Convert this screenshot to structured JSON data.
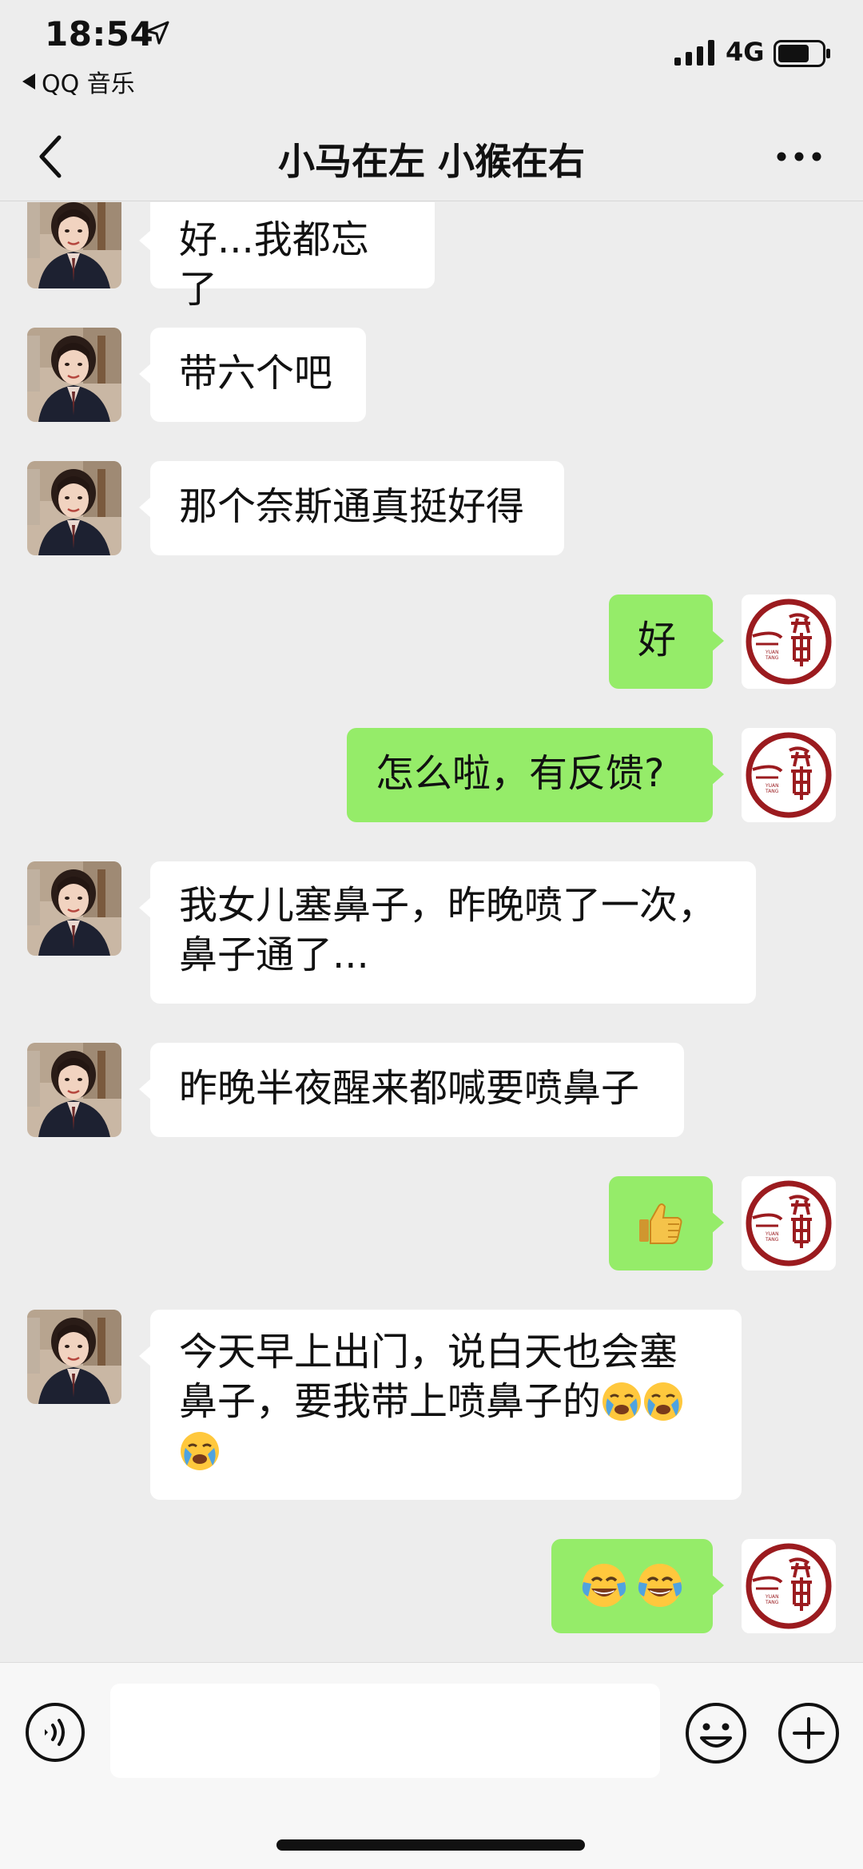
{
  "status_bar": {
    "time": "18:54",
    "back_app": "QQ 音乐",
    "network": "4G"
  },
  "nav": {
    "title": "小马在左 小猴在右"
  },
  "messages": [
    {
      "side": "left",
      "text": "好...我都忘了"
    },
    {
      "side": "left",
      "text": "带六个吧"
    },
    {
      "side": "left",
      "text": "那个奈斯通真挺好得"
    },
    {
      "side": "right",
      "text": "好"
    },
    {
      "side": "right",
      "text": "怎么啦，有反馈?"
    },
    {
      "side": "left",
      "text_line1": "我女儿塞鼻子，昨晚喷了一次，",
      "text_line2": "鼻子通了..."
    },
    {
      "side": "left",
      "text": "昨晚半夜醒来都喊要喷鼻子"
    },
    {
      "side": "right",
      "emoji": "thumbs-up"
    },
    {
      "side": "left",
      "text_line1": "今天早上出门，说白天也会塞",
      "text_line2": "鼻子，要我带上喷鼻子的",
      "trailing_emojis": [
        "loudly-crying-face",
        "loudly-crying-face",
        "loudly-crying-face"
      ]
    },
    {
      "side": "right",
      "emojis": [
        "face-with-tears-of-joy",
        "face-with-tears-of-joy"
      ]
    }
  ],
  "colors": {
    "background": "#ededed",
    "bubble_sent": "#95ec69",
    "bubble_received": "#ffffff",
    "logo_red": "#9b1b1f"
  },
  "icons": {
    "status_location": "location-arrow-icon",
    "signal": "signal-bars-icon",
    "battery": "battery-icon",
    "back": "chevron-left-icon",
    "more": "more-dots-icon",
    "voice": "voice-icon",
    "emoji": "emoji-smile-icon",
    "plus": "plus-circle-icon"
  },
  "input": {
    "value": "",
    "placeholder": ""
  }
}
